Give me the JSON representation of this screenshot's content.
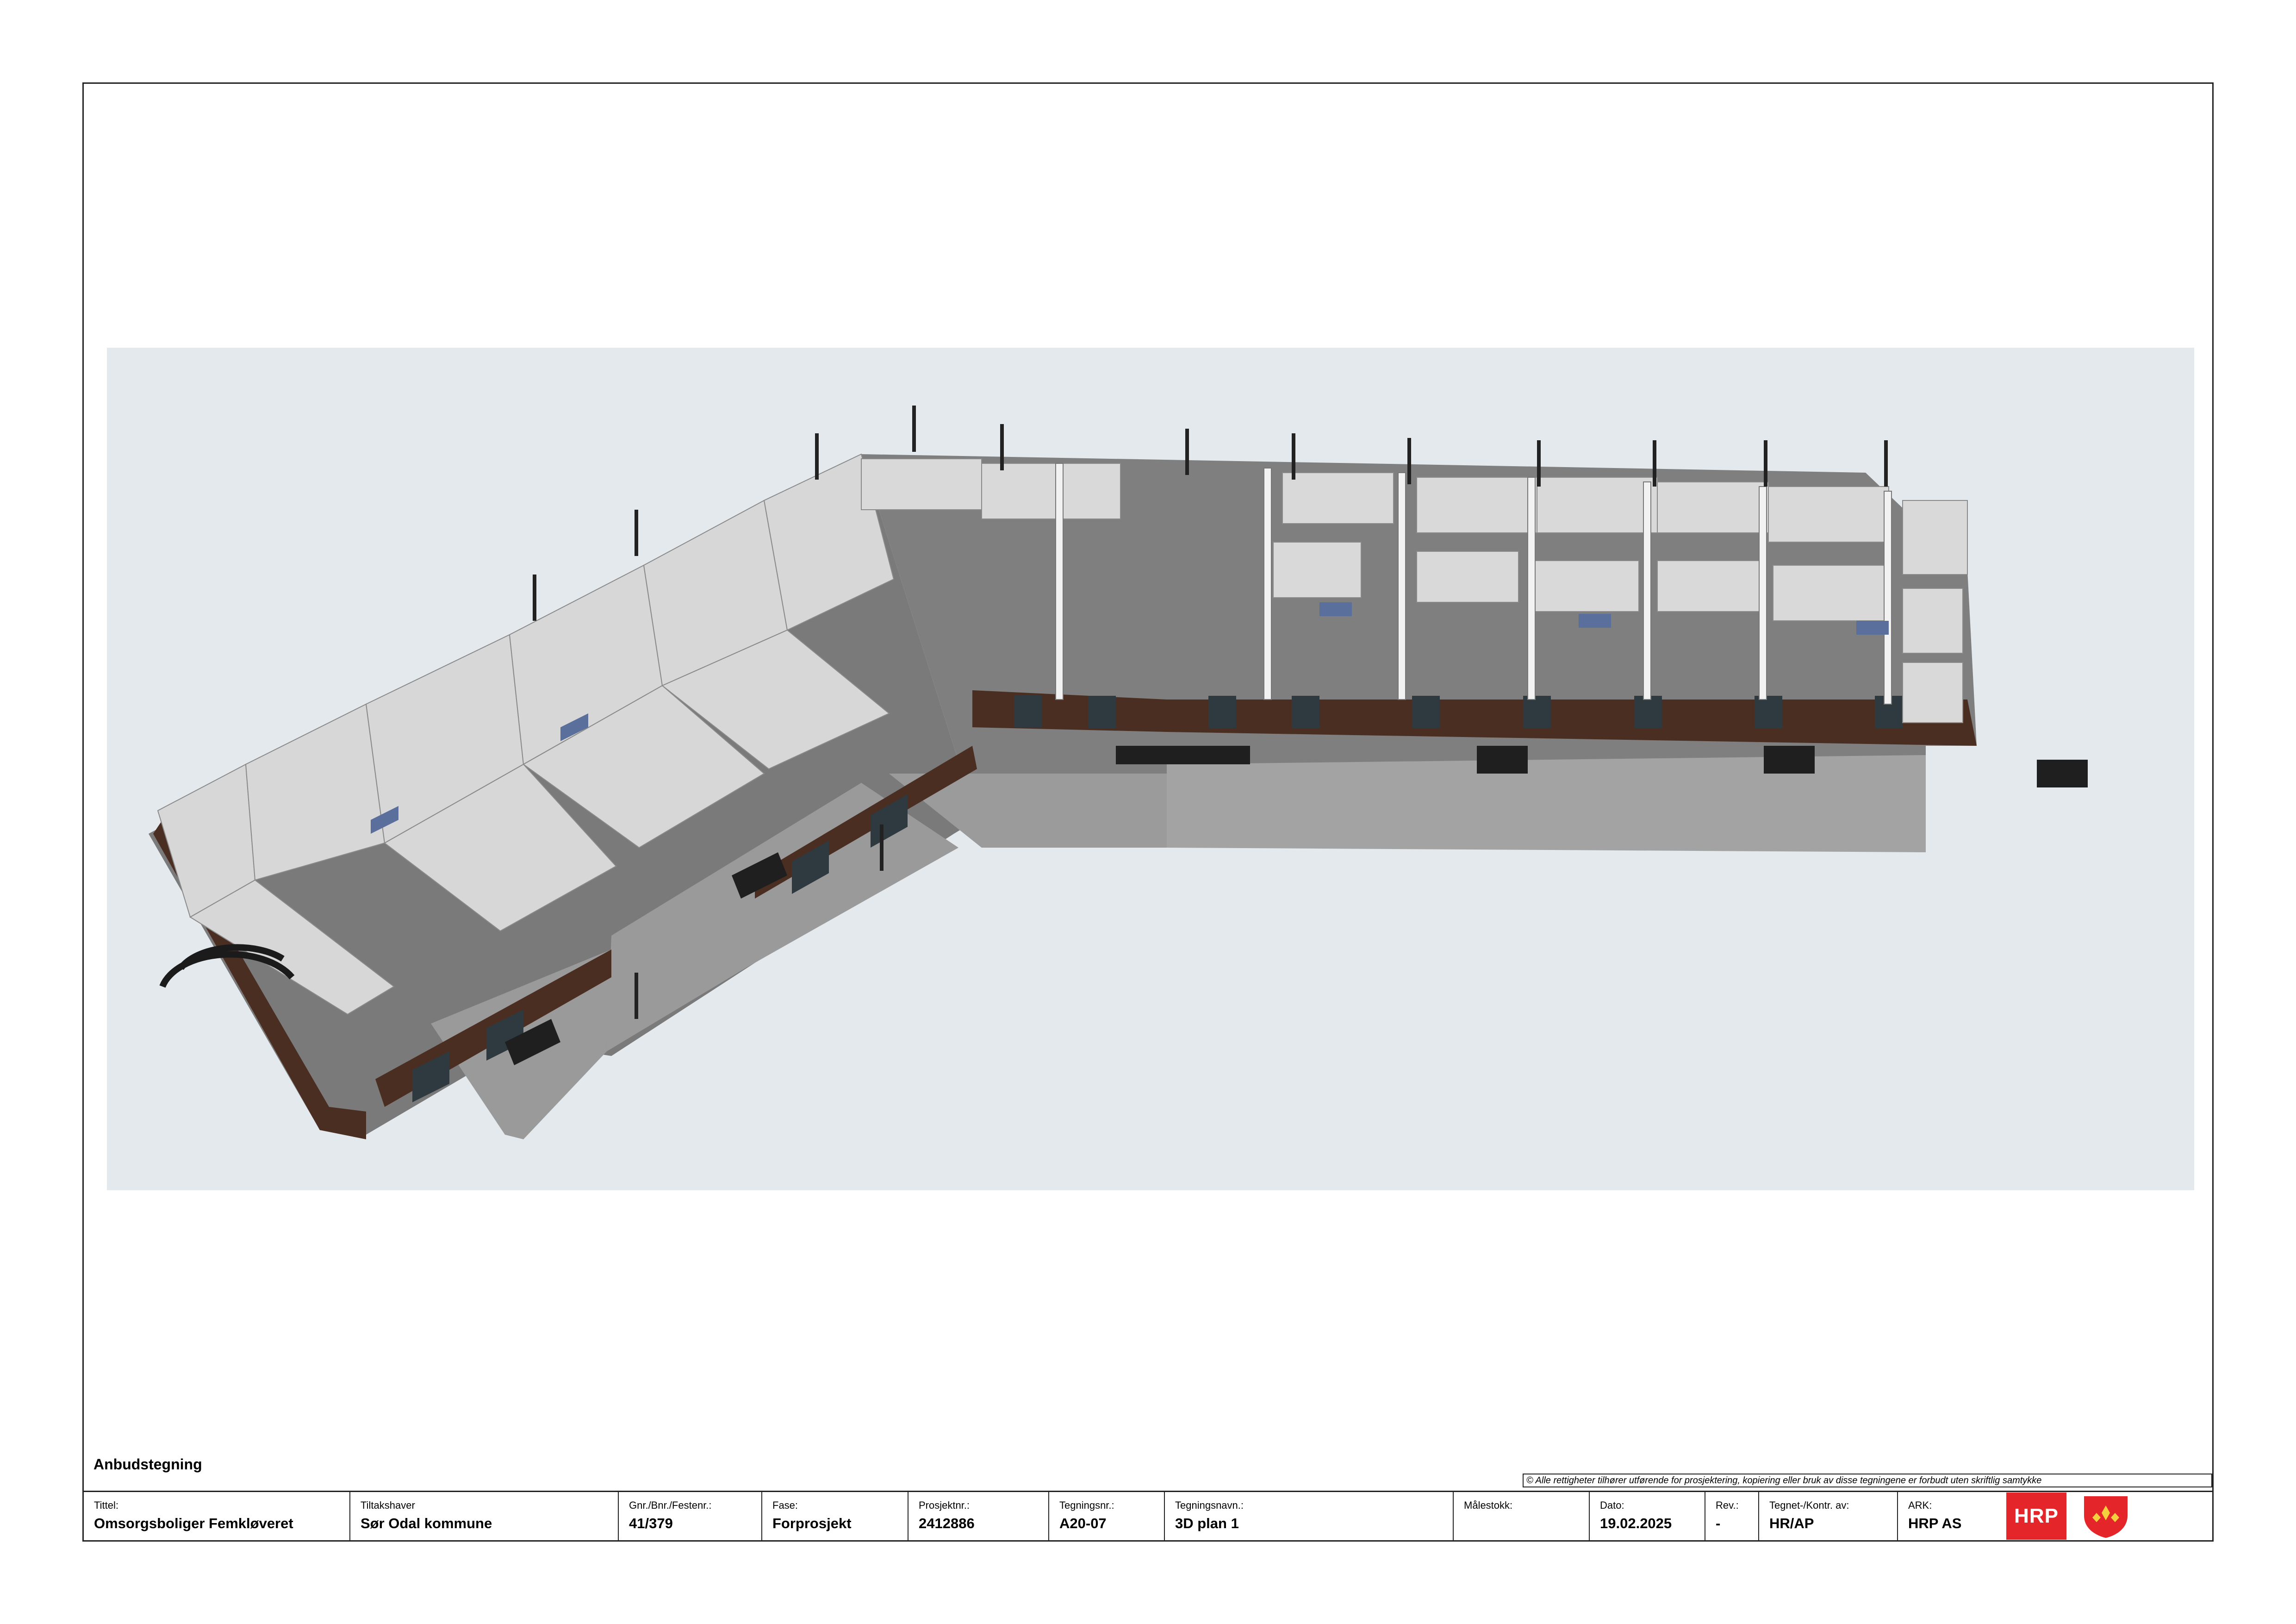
{
  "status_label": "Anbudstegning",
  "copyright": "© Alle rettigheter tilhører utførende for prosjektering, kopiering eller bruk av disse tegningene er forbudt uten skriftlig samtykke",
  "title_block": {
    "tittel": {
      "label": "Tittel:",
      "value": "Omsorgsboliger Femkløveret"
    },
    "tiltakshaver": {
      "label": "Tiltakshaver",
      "value": "Sør Odal kommune"
    },
    "gnr": {
      "label": "Gnr./Bnr./Festenr.:",
      "value": "41/379"
    },
    "fase": {
      "label": "Fase:",
      "value": "Forprosjekt"
    },
    "prosjektnr": {
      "label": "Prosjektnr.:",
      "value": "2412886"
    },
    "tegningsnr": {
      "label": "Tegningsnr.:",
      "value": "A20-07"
    },
    "tegningsnavn": {
      "label": "Tegningsnavn.:",
      "value": "3D plan 1"
    },
    "malestokk": {
      "label": "Målestokk:",
      "value": ""
    },
    "dato": {
      "label": "Dato:",
      "value": "19.02.2025"
    },
    "rev": {
      "label": "Rev.:",
      "value": "-"
    },
    "tegnet": {
      "label": "Tegnet-/Kontr. av:",
      "value": "HR/AP"
    },
    "ark": {
      "label": "ARK:",
      "value": "HRP AS"
    }
  },
  "logo": {
    "text": "HRP",
    "color": "#e4262b"
  },
  "shield_icon": "municipal-coat-of-arms-icon",
  "colors": {
    "render_background": "#e3e9ec",
    "facade": "#4a2e22",
    "floor": "#7d7d7d",
    "wall": "#d6d6d6"
  }
}
